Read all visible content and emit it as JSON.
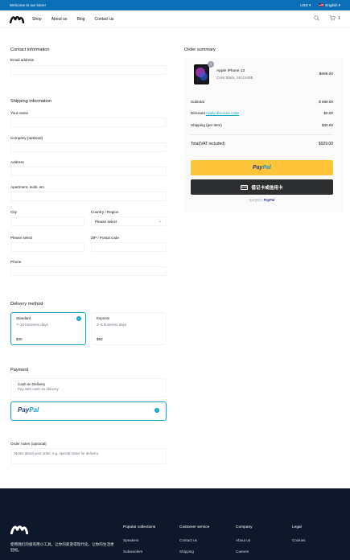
{
  "topbar": {
    "welcome": "Welcome to our store!",
    "currency": "USD ▾",
    "language": "English ▾"
  },
  "nav": {
    "items": [
      "Shop",
      "About us",
      "Blog",
      "Contact us"
    ],
    "cart_count": "1"
  },
  "contact": {
    "title": "Contact information",
    "email_label": "Email address"
  },
  "shipping": {
    "title": "Shipping information",
    "name_label": "Your name",
    "company_label": "Company (optional)",
    "address_label": "Address",
    "apartment_label": "Apartment, suits, etc.",
    "city_label": "City",
    "country_label": "Country / Region",
    "country_value": "Please select",
    "state_label": "Please select",
    "zip_label": "ZIP / Postal code",
    "phone_label": "Phone"
  },
  "delivery": {
    "title": "Delivery method",
    "options": [
      {
        "name": "Standard",
        "eta": "7–10 business days",
        "price": "$30"
      },
      {
        "name": "Express",
        "eta": "2–5 business days",
        "price": "$50"
      }
    ]
  },
  "payment": {
    "title": "Payment",
    "cod_title": "Cash on Delivery",
    "cod_sub": "Pay with cash on delivery",
    "paypal_a": "Pay",
    "paypal_b": "Pal"
  },
  "notes": {
    "label": "Order notes (optional)",
    "placeholder": "Notes about your order, e.g. special notes for delivery."
  },
  "summary": {
    "title": "Order summary",
    "item_qty": "1",
    "item_name": "Apple iPhone 13",
    "item_variant": "Color:Black, SKU:640B",
    "item_price": "$699.00",
    "subtotal_label": "Subtotal",
    "subtotal_value": "$ 699.00",
    "discount_label": "Discount",
    "discount_link": "Apply discount code",
    "discount_value": "$0.00",
    "shipping_label": "Shipping",
    "shipping_sub": "(per item)",
    "shipping_value": "$30.00",
    "total_label": "Total(VAT included)",
    "total_value": "$929.00",
    "card_btn": "借记卡或信用卡",
    "powered_prefix": "技术提供方",
    "powered_brand": "PayPal"
  },
  "footer": {
    "tagline": "使用我们的极有用小工具，让你的家变得现代化。让你的生活更轻松。",
    "cols": [
      {
        "title": "Popular collections",
        "links": [
          "Speakers",
          "Subwoofers"
        ]
      },
      {
        "title": "Customer service",
        "links": [
          "Contact us",
          "Shipping"
        ]
      },
      {
        "title": "Company",
        "links": [
          "About us",
          "Careers"
        ]
      },
      {
        "title": "Legal",
        "links": [
          "Cookies"
        ]
      }
    ]
  },
  "colors": {
    "topbar": "#0b6fb8",
    "accent": "#0ea5c6",
    "paypal_yellow": "#ffc439",
    "footer": "#0f172a"
  }
}
